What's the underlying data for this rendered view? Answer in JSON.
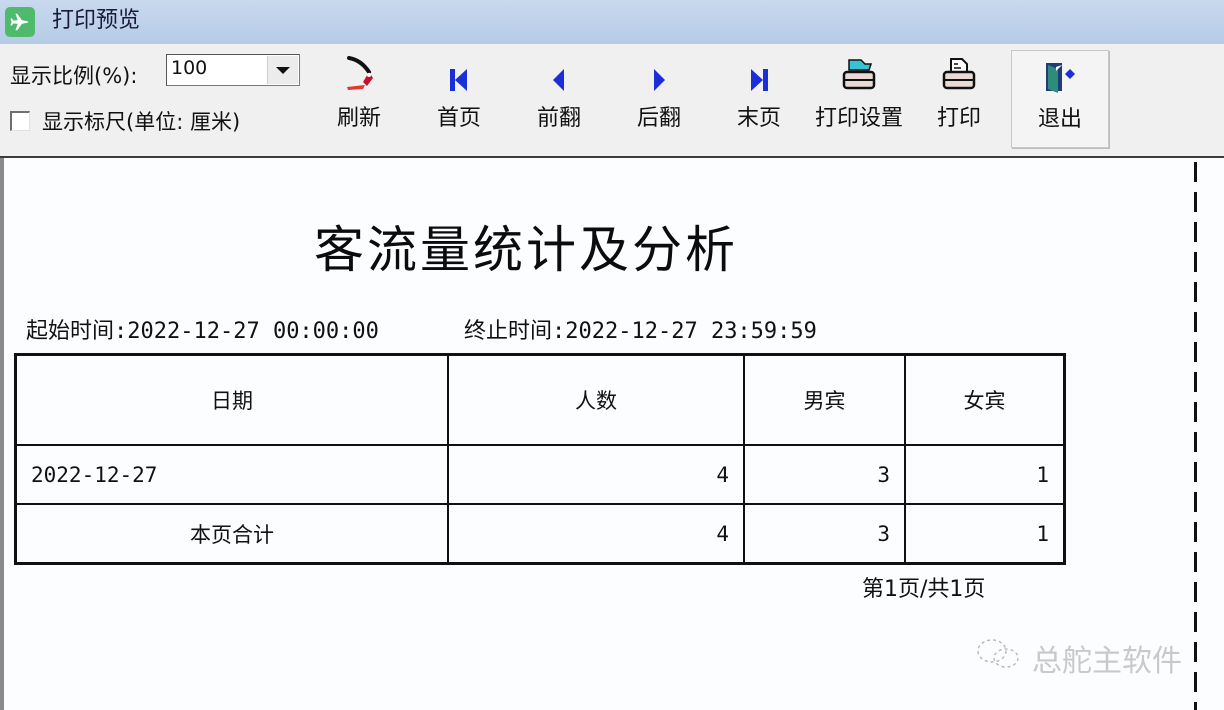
{
  "window": {
    "title": "打印预览",
    "app_icon": "airplane-icon"
  },
  "toolbar": {
    "scale_label": "显示比例(%):",
    "scale_value": "100",
    "ruler_checkbox_checked": false,
    "ruler_label": "显示标尺(单位: 厘米)",
    "buttons": [
      {
        "id": "refresh",
        "label": "刷新",
        "icon": "refresh-icon"
      },
      {
        "id": "first",
        "label": "首页",
        "icon": "first-page-icon"
      },
      {
        "id": "prev",
        "label": "前翻",
        "icon": "previous-page-icon"
      },
      {
        "id": "next",
        "label": "后翻",
        "icon": "next-page-icon"
      },
      {
        "id": "last",
        "label": "末页",
        "icon": "last-page-icon"
      },
      {
        "id": "print_settings",
        "label": "打印设置",
        "icon": "printer-settings-icon"
      },
      {
        "id": "print",
        "label": "打印",
        "icon": "printer-icon"
      },
      {
        "id": "exit",
        "label": "退出",
        "icon": "exit-door-icon"
      }
    ],
    "colors": {
      "nav_arrow": "#1a2fd6",
      "title_bar": "#c3d5ec"
    }
  },
  "report": {
    "title": "客流量统计及分析",
    "start_label": "起始时间:",
    "start_time": "2022-12-27 00:00:00",
    "end_label": "终止时间:",
    "end_time": "2022-12-27 23:59:59",
    "columns": [
      "日期",
      "人数",
      "男宾",
      "女宾"
    ],
    "rows": [
      {
        "date": "2022-12-27",
        "total": "4",
        "male": "3",
        "female": "1"
      }
    ],
    "subtotal": {
      "label": "本页合计",
      "total": "4",
      "male": "3",
      "female": "1"
    },
    "page_indicator": "第1页/共1页"
  },
  "watermark": {
    "text": "总舵主软件",
    "icon": "wechat-icon"
  }
}
